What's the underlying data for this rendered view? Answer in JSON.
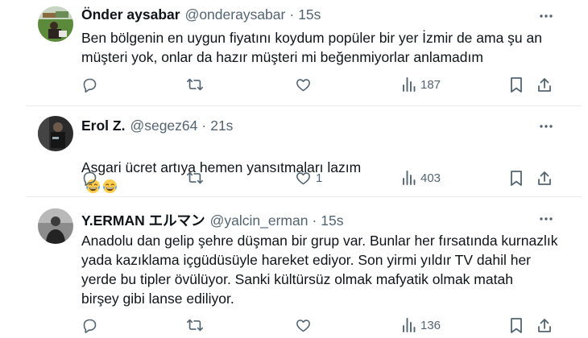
{
  "tweets": [
    {
      "name": "Önder aysabar",
      "handle": "@onderaysabar",
      "separator": "·",
      "time": "15s",
      "text": "Ben bölgenin en uygun fiyatını koydum popüler bir yer İzmir de ama şu an\nmüşteri yok, onlar da hazır müşteri mi beğenmiyorlar anlamadım",
      "likes": "",
      "views": "187"
    },
    {
      "name": "Erol Z.",
      "handle": "@segez64",
      "separator": "·",
      "time": "21s",
      "text": "Asgari ücret artıya hemen yansıtmaları lazım",
      "emoji": [
        "face-with-tears-of-joy",
        "face-with-tears-of-joy"
      ],
      "likes": "1",
      "views": "403"
    },
    {
      "name": "Y.ERMAN エルマン",
      "handle": "@yalcin_erman",
      "separator": "·",
      "time": "15s",
      "text": "Anadolu dan gelip şehre düşman bir grup var. Bunlar her fırsatında kurnazlık\nyada kazıklama içgüdüsüyle hareket ediyor. Son yirmi yıldır TV dahil her\nyerde bu tipler övülüyor. Sanki kültürsüz olmak mafyatik olmak matah\nbirşey gibi lanse ediliyor.",
      "likes": "",
      "views": "136"
    }
  ],
  "icons": {
    "reply": "reply-icon",
    "retweet": "retweet-icon",
    "like": "like-icon",
    "views": "views-icon",
    "bookmark": "bookmark-icon",
    "share": "share-icon",
    "more": "more-icon"
  },
  "colors": {
    "text": "#0f1419",
    "secondary": "#536471",
    "divider": "#e7e9ea"
  }
}
